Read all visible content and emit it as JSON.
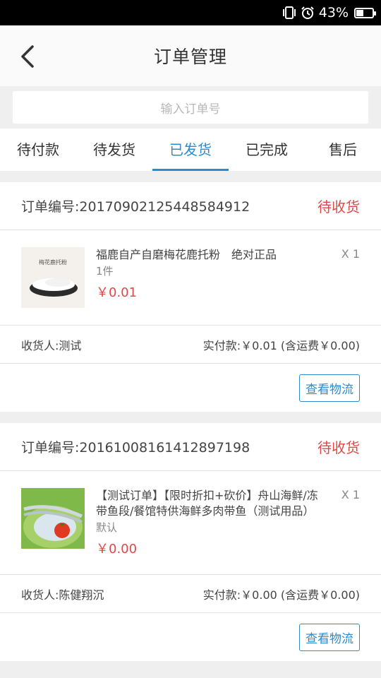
{
  "status_bar": {
    "battery": "43%",
    "battery_level": 0.43
  },
  "header": {
    "title": "订单管理"
  },
  "search": {
    "placeholder": "输入订单号"
  },
  "tabs": [
    {
      "label": "待付款"
    },
    {
      "label": "待发货"
    },
    {
      "label": "已发货",
      "active": true
    },
    {
      "label": "已完成"
    },
    {
      "label": "售后"
    }
  ],
  "orders": [
    {
      "order_no": "订单编号:20170902125448584912",
      "status": "待收货",
      "item": {
        "name": "福鹿自产自磨梅花鹿托粉　绝对正品",
        "spec": "1件",
        "price": "￥0.01",
        "qty": "X 1",
        "image_text": "梅花鹿托粉"
      },
      "receiver": "收货人:测试",
      "payment": "实付款:￥0.01 (含运费￥0.00)",
      "logistics_button": "查看物流"
    },
    {
      "order_no": "订单编号:20161008161412897198",
      "status": "待收货",
      "item": {
        "name": "【测试订单】【限时折扣+砍价】舟山海鲜/冻带鱼段/餐馆特供海鲜多肉带鱼（测试用品）",
        "spec": "默认",
        "price": "￥0.00",
        "qty": "X 1"
      },
      "receiver": "收货人:陈健翔沉",
      "payment": "实付款:￥0.00 (含运费￥0.00)",
      "logistics_button": "查看物流"
    }
  ],
  "colors": {
    "accent": "#2a8bd0",
    "price": "#e04848"
  }
}
